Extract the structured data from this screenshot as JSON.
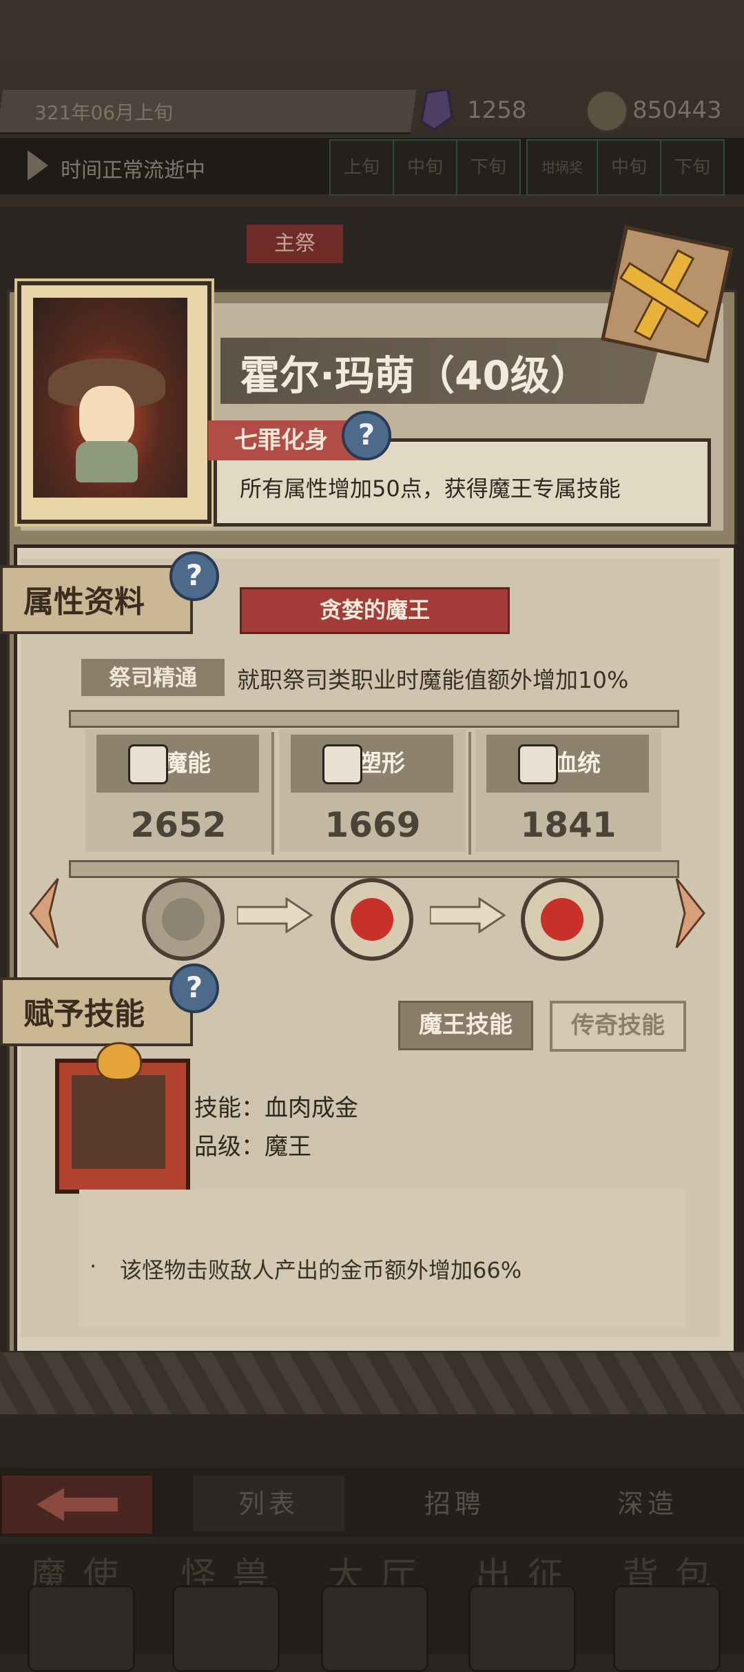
{
  "header": {
    "date": "321年06月上旬",
    "crystal_count": "1258",
    "gold_count": "850443",
    "time_status": "时间正常流逝中",
    "time_segments": [
      "上旬",
      "中旬",
      "下旬"
    ],
    "pot_label": "坩埚奖",
    "pot_segments": [
      "中旬",
      "下旬"
    ]
  },
  "tabs": {
    "active": "主祭"
  },
  "character": {
    "name": "霍尔·玛萌（40级）",
    "trait_tag": "七罪化身",
    "trait_desc": "所有属性增加50点，获得魔王专属技能"
  },
  "attributes": {
    "section_label": "属性资料",
    "title": "贪婪的魔王",
    "bonus_tag": "祭司精通",
    "bonus_text": "就职祭司类职业时魔能值额外增加10%",
    "stats": [
      {
        "label": "魔能",
        "value": "2652",
        "icon": "magic-icon"
      },
      {
        "label": "塑形",
        "value": "1669",
        "icon": "body-icon"
      },
      {
        "label": "血统",
        "value": "1841",
        "icon": "bloodline-icon"
      }
    ]
  },
  "skills": {
    "section_label": "赋予技能",
    "tab_demon": "魔王技能",
    "tab_legend": "传奇技能",
    "skill_line": "技能：血肉成金",
    "grade_line": "品级：魔王",
    "bullet": "·",
    "description": "该怪物击败敌人产出的金币额外增加66%"
  },
  "navigation": {
    "tabs": [
      "列表",
      "招聘",
      "深造"
    ],
    "menu": [
      "魔使",
      "怪兽",
      "大厅",
      "出征",
      "背包"
    ]
  },
  "colors": {
    "accent_red": "#a33b38",
    "paper": "#d9cfb9",
    "help_blue": "#4d6a8a",
    "gold": "#e8b13a"
  }
}
